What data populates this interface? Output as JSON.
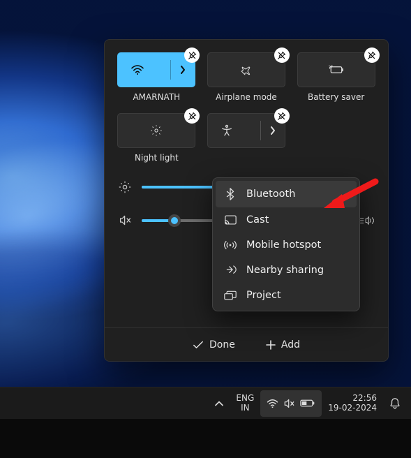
{
  "colors": {
    "accent": "#4cc2ff"
  },
  "tiles": [
    {
      "id": "wifi",
      "label": "AMARNATH",
      "active": true,
      "hasExpand": true
    },
    {
      "id": "airplane",
      "label": "Airplane mode",
      "active": false,
      "hasExpand": false
    },
    {
      "id": "battery-saver",
      "label": "Battery saver",
      "active": false,
      "hasExpand": false
    },
    {
      "id": "night-light",
      "label": "Night light",
      "active": false,
      "hasExpand": false
    },
    {
      "id": "accessibility",
      "label": "",
      "active": false,
      "hasExpand": true
    }
  ],
  "sliders": {
    "brightness": {
      "percent": 48
    },
    "volume": {
      "percent": 16,
      "muted": true
    }
  },
  "footer": {
    "done": "Done",
    "add": "Add"
  },
  "add_menu": {
    "items": [
      {
        "id": "bluetooth",
        "label": "Bluetooth"
      },
      {
        "id": "cast",
        "label": "Cast"
      },
      {
        "id": "hotspot",
        "label": "Mobile hotspot"
      },
      {
        "id": "nearby",
        "label": "Nearby sharing"
      },
      {
        "id": "project",
        "label": "Project"
      }
    ],
    "hovered": "bluetooth"
  },
  "taskbar": {
    "lang1": "ENG",
    "lang2": "IN",
    "time": "22:56",
    "date": "19-02-2024"
  }
}
